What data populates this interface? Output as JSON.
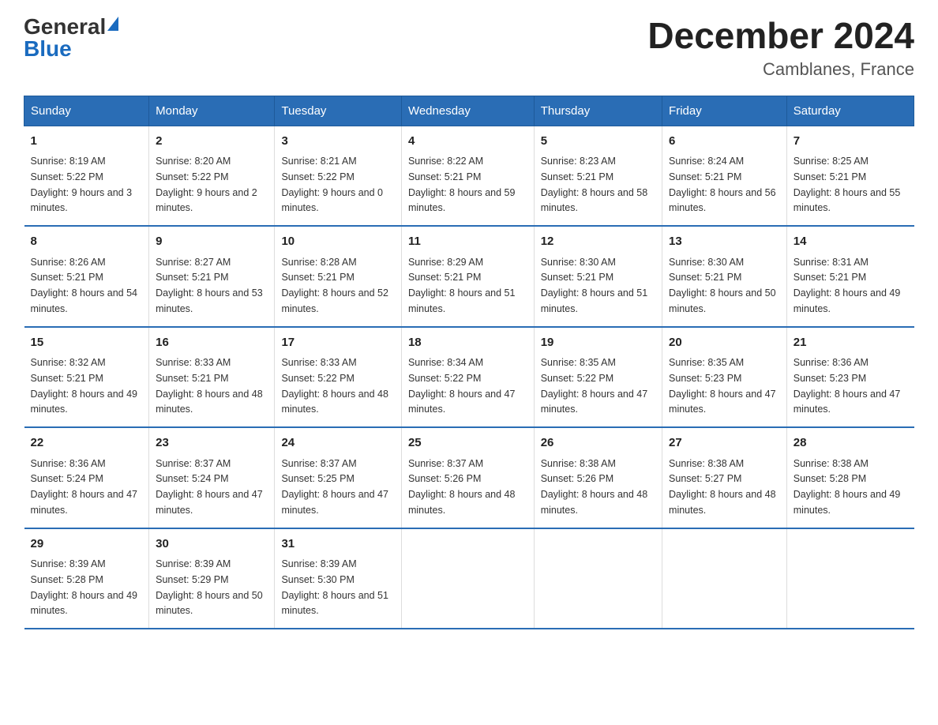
{
  "logo": {
    "general": "General",
    "blue": "Blue"
  },
  "title": "December 2024",
  "location": "Camblanes, France",
  "days_of_week": [
    "Sunday",
    "Monday",
    "Tuesday",
    "Wednesday",
    "Thursday",
    "Friday",
    "Saturday"
  ],
  "weeks": [
    [
      {
        "day": "1",
        "sunrise": "8:19 AM",
        "sunset": "5:22 PM",
        "daylight": "9 hours and 3 minutes."
      },
      {
        "day": "2",
        "sunrise": "8:20 AM",
        "sunset": "5:22 PM",
        "daylight": "9 hours and 2 minutes."
      },
      {
        "day": "3",
        "sunrise": "8:21 AM",
        "sunset": "5:22 PM",
        "daylight": "9 hours and 0 minutes."
      },
      {
        "day": "4",
        "sunrise": "8:22 AM",
        "sunset": "5:21 PM",
        "daylight": "8 hours and 59 minutes."
      },
      {
        "day": "5",
        "sunrise": "8:23 AM",
        "sunset": "5:21 PM",
        "daylight": "8 hours and 58 minutes."
      },
      {
        "day": "6",
        "sunrise": "8:24 AM",
        "sunset": "5:21 PM",
        "daylight": "8 hours and 56 minutes."
      },
      {
        "day": "7",
        "sunrise": "8:25 AM",
        "sunset": "5:21 PM",
        "daylight": "8 hours and 55 minutes."
      }
    ],
    [
      {
        "day": "8",
        "sunrise": "8:26 AM",
        "sunset": "5:21 PM",
        "daylight": "8 hours and 54 minutes."
      },
      {
        "day": "9",
        "sunrise": "8:27 AM",
        "sunset": "5:21 PM",
        "daylight": "8 hours and 53 minutes."
      },
      {
        "day": "10",
        "sunrise": "8:28 AM",
        "sunset": "5:21 PM",
        "daylight": "8 hours and 52 minutes."
      },
      {
        "day": "11",
        "sunrise": "8:29 AM",
        "sunset": "5:21 PM",
        "daylight": "8 hours and 51 minutes."
      },
      {
        "day": "12",
        "sunrise": "8:30 AM",
        "sunset": "5:21 PM",
        "daylight": "8 hours and 51 minutes."
      },
      {
        "day": "13",
        "sunrise": "8:30 AM",
        "sunset": "5:21 PM",
        "daylight": "8 hours and 50 minutes."
      },
      {
        "day": "14",
        "sunrise": "8:31 AM",
        "sunset": "5:21 PM",
        "daylight": "8 hours and 49 minutes."
      }
    ],
    [
      {
        "day": "15",
        "sunrise": "8:32 AM",
        "sunset": "5:21 PM",
        "daylight": "8 hours and 49 minutes."
      },
      {
        "day": "16",
        "sunrise": "8:33 AM",
        "sunset": "5:21 PM",
        "daylight": "8 hours and 48 minutes."
      },
      {
        "day": "17",
        "sunrise": "8:33 AM",
        "sunset": "5:22 PM",
        "daylight": "8 hours and 48 minutes."
      },
      {
        "day": "18",
        "sunrise": "8:34 AM",
        "sunset": "5:22 PM",
        "daylight": "8 hours and 47 minutes."
      },
      {
        "day": "19",
        "sunrise": "8:35 AM",
        "sunset": "5:22 PM",
        "daylight": "8 hours and 47 minutes."
      },
      {
        "day": "20",
        "sunrise": "8:35 AM",
        "sunset": "5:23 PM",
        "daylight": "8 hours and 47 minutes."
      },
      {
        "day": "21",
        "sunrise": "8:36 AM",
        "sunset": "5:23 PM",
        "daylight": "8 hours and 47 minutes."
      }
    ],
    [
      {
        "day": "22",
        "sunrise": "8:36 AM",
        "sunset": "5:24 PM",
        "daylight": "8 hours and 47 minutes."
      },
      {
        "day": "23",
        "sunrise": "8:37 AM",
        "sunset": "5:24 PM",
        "daylight": "8 hours and 47 minutes."
      },
      {
        "day": "24",
        "sunrise": "8:37 AM",
        "sunset": "5:25 PM",
        "daylight": "8 hours and 47 minutes."
      },
      {
        "day": "25",
        "sunrise": "8:37 AM",
        "sunset": "5:26 PM",
        "daylight": "8 hours and 48 minutes."
      },
      {
        "day": "26",
        "sunrise": "8:38 AM",
        "sunset": "5:26 PM",
        "daylight": "8 hours and 48 minutes."
      },
      {
        "day": "27",
        "sunrise": "8:38 AM",
        "sunset": "5:27 PM",
        "daylight": "8 hours and 48 minutes."
      },
      {
        "day": "28",
        "sunrise": "8:38 AM",
        "sunset": "5:28 PM",
        "daylight": "8 hours and 49 minutes."
      }
    ],
    [
      {
        "day": "29",
        "sunrise": "8:39 AM",
        "sunset": "5:28 PM",
        "daylight": "8 hours and 49 minutes."
      },
      {
        "day": "30",
        "sunrise": "8:39 AM",
        "sunset": "5:29 PM",
        "daylight": "8 hours and 50 minutes."
      },
      {
        "day": "31",
        "sunrise": "8:39 AM",
        "sunset": "5:30 PM",
        "daylight": "8 hours and 51 minutes."
      },
      null,
      null,
      null,
      null
    ]
  ],
  "labels": {
    "sunrise": "Sunrise:",
    "sunset": "Sunset:",
    "daylight": "Daylight:"
  }
}
